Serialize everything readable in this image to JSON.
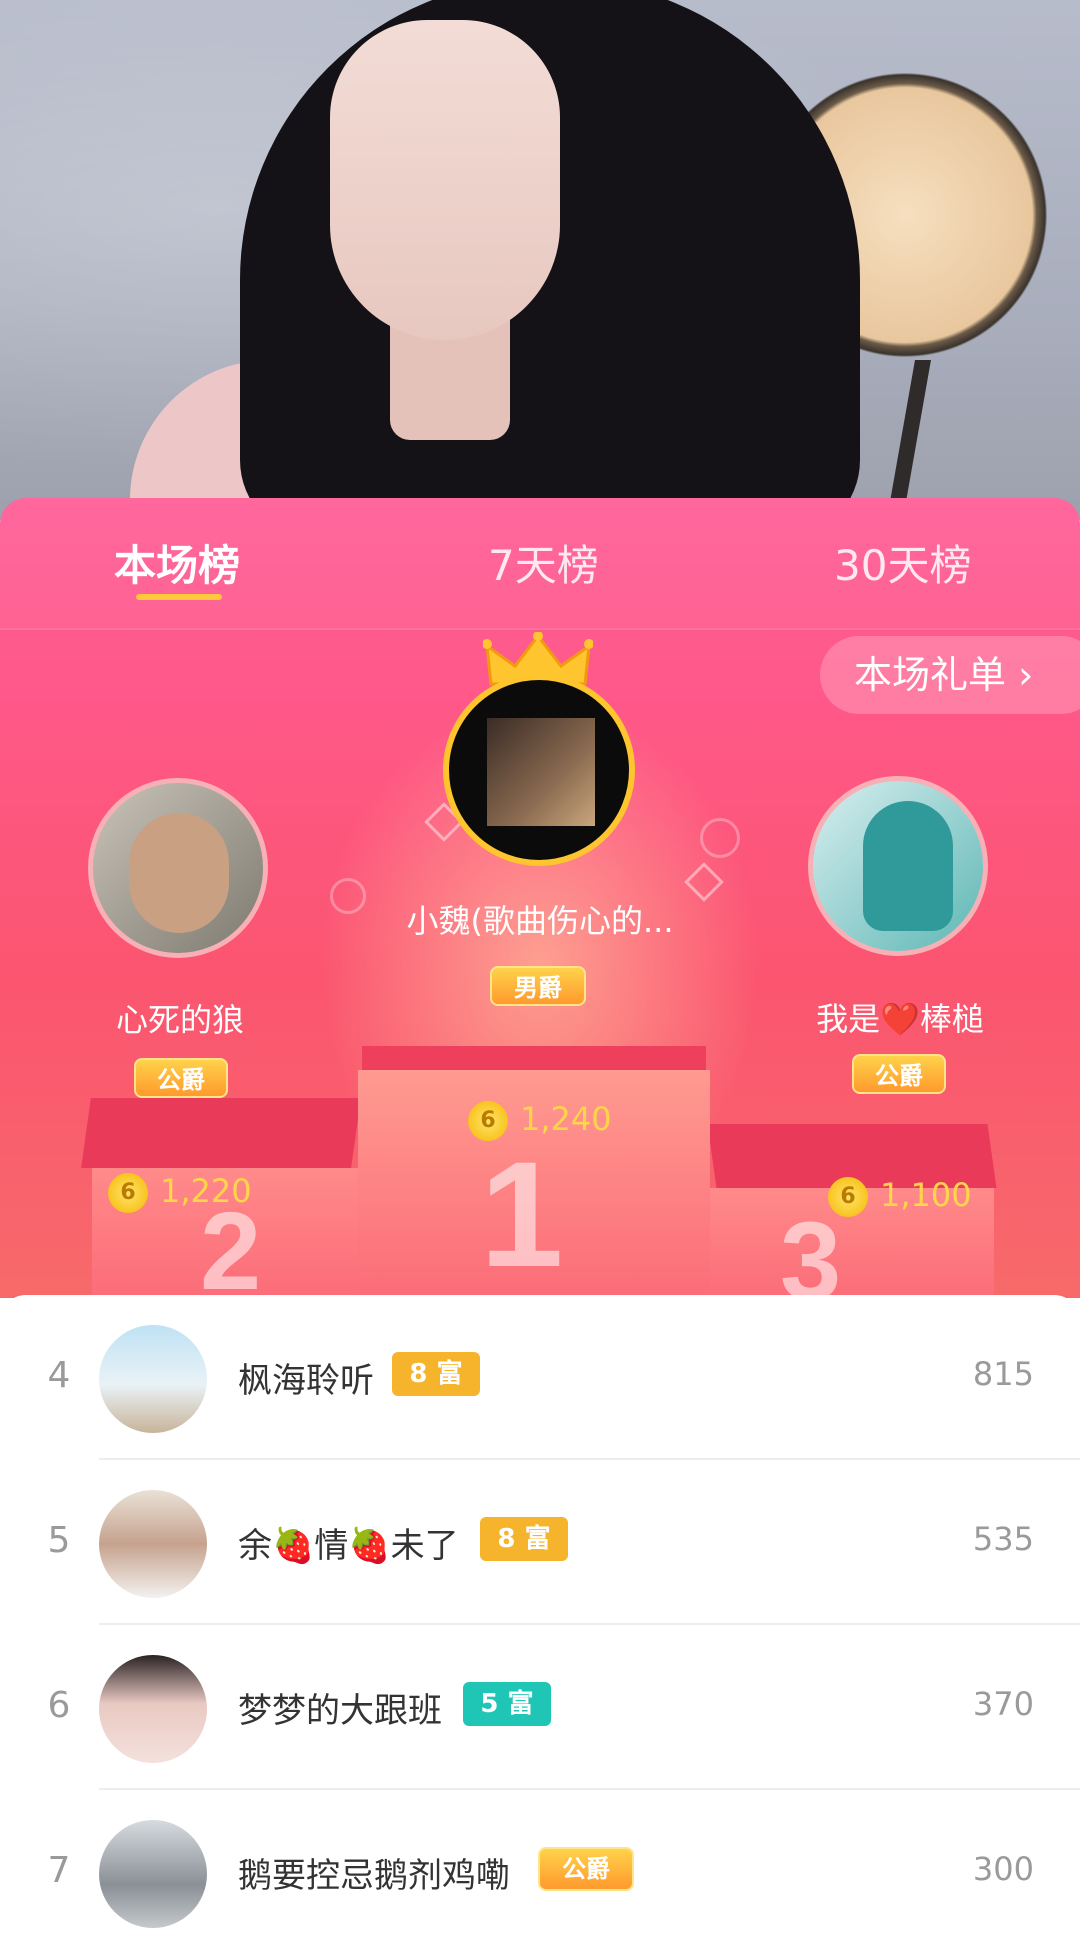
{
  "tabs": [
    {
      "label": "本场榜",
      "active": true
    },
    {
      "label": "7天榜",
      "active": false
    },
    {
      "label": "30天榜",
      "active": false
    }
  ],
  "gift_list_button": "本场礼单 ›",
  "podium": {
    "first": {
      "name": "小魏(歌曲伤心的...",
      "badge": "男爵",
      "score": "1,240",
      "rank_label": "1"
    },
    "second": {
      "name": "心死的狼",
      "badge": "公爵",
      "score": "1,220",
      "rank_label": "2"
    },
    "third": {
      "name": "我是❤️棒槌",
      "badge": "公爵",
      "score": "1,100",
      "rank_label": "3"
    },
    "coin_symbol": "6"
  },
  "list": [
    {
      "rank": "4",
      "name": "枫海聆听",
      "level": "8 富",
      "level_color": "#f6b42d",
      "score": "815"
    },
    {
      "rank": "5",
      "name": "余🍓情🍓未了",
      "level": "8 富",
      "level_color": "#f6b42d",
      "score": "535"
    },
    {
      "rank": "6",
      "name": "梦梦的大跟班",
      "level": "5 富",
      "level_color": "#1fc5b5",
      "score": "370"
    },
    {
      "rank": "7",
      "name": "鹅要控忌鹅剂鸡嘞",
      "level": "公爵",
      "level_color": "#ff8a2e",
      "score": "300"
    }
  ]
}
